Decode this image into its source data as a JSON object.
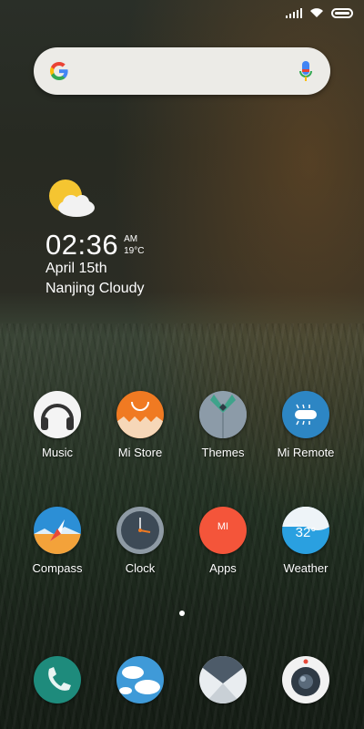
{
  "status_bar": {
    "signal_icon": "signal-icon",
    "wifi_icon": "wifi-icon",
    "battery_icon": "battery-icon"
  },
  "search_bar": {
    "logo": "google-g-icon",
    "mic_icon": "mic-icon"
  },
  "weather_widget": {
    "icon": "partly-cloudy-icon",
    "time": "02:36",
    "ampm": "AM",
    "temperature": "19°C",
    "date": "April 15th",
    "location_condition": "Nanjing Cloudy"
  },
  "apps": [
    {
      "label": "Music",
      "icon": "headphones-icon"
    },
    {
      "label": "Mi Store",
      "icon": "mi-store-bag-icon"
    },
    {
      "label": "Themes",
      "icon": "themes-shirt-icon"
    },
    {
      "label": "Mi Remote",
      "icon": "remote-bug-icon"
    },
    {
      "label": "Compass",
      "icon": "compass-icon"
    },
    {
      "label": "Clock",
      "icon": "clock-icon"
    },
    {
      "label": "Apps",
      "icon": "mi-apps-icon"
    },
    {
      "label": "Weather",
      "icon": "weather-icon",
      "badge": "32°"
    }
  ],
  "page_indicator": {
    "pages": 2,
    "current": 1
  },
  "dock": [
    {
      "icon": "phone-icon"
    },
    {
      "icon": "gallery-sky-icon"
    },
    {
      "icon": "browser-icon"
    },
    {
      "icon": "camera-icon"
    }
  ]
}
